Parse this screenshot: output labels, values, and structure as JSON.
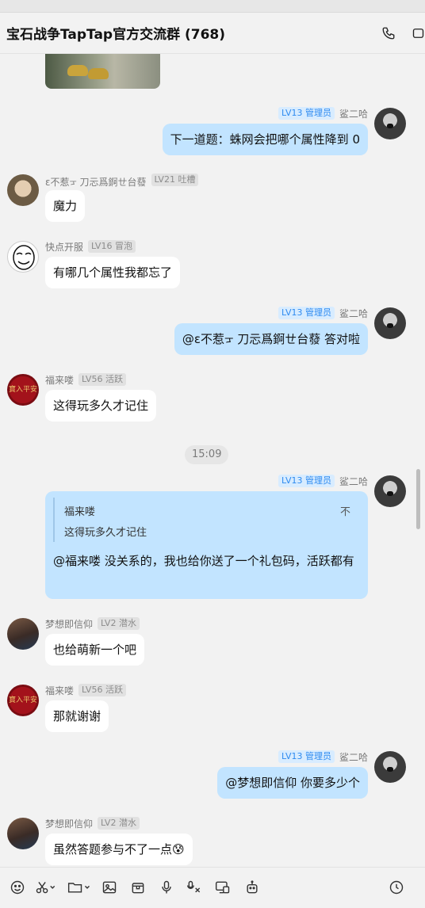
{
  "header": {
    "title": "宝石战争TapTap官方交流群 (768)",
    "icons": [
      "phone-icon",
      "video-icon"
    ]
  },
  "messages": [
    {
      "type": "image",
      "from": "self-prev"
    },
    {
      "sender": "鲨二哈",
      "badge": "LV13 管理员",
      "text": "下一道题：蛛网会把哪个属性降到 0"
    },
    {
      "sender": "ɛ不惹ᠴ 刀忈爲錒ㄝ台蕟",
      "badge": "LV21 吐槽",
      "text": "魔力"
    },
    {
      "sender": "快点开服",
      "badge": "LV16 冒泡",
      "text": "有哪几个属性我都忘了"
    },
    {
      "sender": "鲨二哈",
      "badge": "LV13 管理员",
      "text": "@ɛ不惹ᠴ 刀忈爲錒ㄝ台蕟  答对啦"
    },
    {
      "sender": "福来喽",
      "badge": "LV56 活跃",
      "text": "这得玩多久才记住"
    },
    {
      "time": "15:09"
    },
    {
      "sender": "鲨二哈",
      "badge": "LV13 管理员",
      "quote_name": "福来喽",
      "quote_text": "这得玩多久才记住",
      "quote_close": "不",
      "text": "@福来喽 没关系的，我也给你送了一个礼包码，活跃都有"
    },
    {
      "sender": "梦想即信仰",
      "badge": "LV2 潜水",
      "text": "也给萌新一个吧"
    },
    {
      "sender": "福来喽",
      "badge": "LV56 活跃",
      "text": "那就谢谢"
    },
    {
      "sender": "鲨二哈",
      "badge": "LV13 管理员",
      "text": "@梦想即信仰 你要多少个"
    },
    {
      "sender": "梦想即信仰",
      "badge": "LV2 潜水",
      "text": "虽然答题参与不了一点😰"
    }
  ],
  "avatar_text": {
    "fulaisou": "寶入平安"
  },
  "toolbar": {
    "icons": [
      "emoji-icon",
      "scissors-icon",
      "folder-icon",
      "image-icon",
      "gift-box-icon",
      "microphone-icon",
      "voice-text-icon",
      "screen-share-icon",
      "robot-icon",
      "history-clock-icon"
    ]
  },
  "colors": {
    "bubble_self": "#c2e4ff",
    "bubble_other": "#ffffff",
    "background": "#f2f2f2",
    "admin_badge_text": "#2f8bf0",
    "admin_badge_bg": "#d8ecff",
    "level_badge_bg": "#e1e1e1"
  }
}
